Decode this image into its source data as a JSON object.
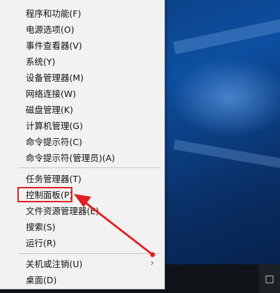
{
  "menu": {
    "items": [
      {
        "label": "程序和功能(F)"
      },
      {
        "label": "电源选项(O)"
      },
      {
        "label": "事件查看器(V)"
      },
      {
        "label": "系统(Y)"
      },
      {
        "label": "设备管理器(M)"
      },
      {
        "label": "网络连接(W)"
      },
      {
        "label": "磁盘管理(K)"
      },
      {
        "label": "计算机管理(G)"
      },
      {
        "label": "命令提示符(C)"
      },
      {
        "label": "命令提示符(管理员)(A)"
      },
      {
        "label": "任务管理器(T)"
      },
      {
        "label": "控制面板(P)"
      },
      {
        "label": "文件资源管理器(E)"
      },
      {
        "label": "搜索(S)"
      },
      {
        "label": "运行(R)"
      },
      {
        "label": "关机或注销(U)"
      },
      {
        "label": "桌面(D)"
      }
    ],
    "submenu_icon": "chevron-right-icon",
    "highlighted_item": "控制面板(P)"
  },
  "annotation": {
    "box_color": "#e02020",
    "arrow_color": "#e02020"
  },
  "taskbar": {
    "tray_icon": "action-center-icon"
  }
}
